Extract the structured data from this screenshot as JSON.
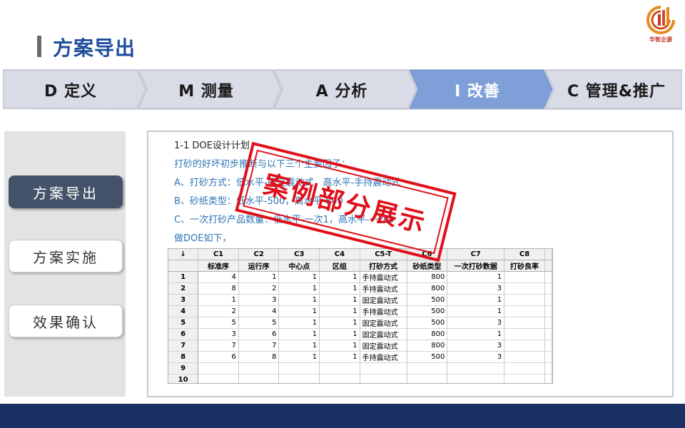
{
  "header": {
    "title": "方案导出",
    "logo_text": "华智企源"
  },
  "steps": [
    {
      "label": "D 定义",
      "active": false
    },
    {
      "label": "M 测量",
      "active": false
    },
    {
      "label": "A 分析",
      "active": false
    },
    {
      "label": "I 改善",
      "active": true
    },
    {
      "label": "C 管理&推广",
      "active": false
    }
  ],
  "sidebar": {
    "items": [
      {
        "label": "方案导出",
        "active": true
      },
      {
        "label": "方案实施",
        "active": false
      },
      {
        "label": "效果确认",
        "active": false
      }
    ]
  },
  "content": {
    "heading": "1-1 DOE设计计划",
    "lines": [
      "打砂的好坏初步推断与以下三个主要因子：",
      "A、打砂方式：低水平-固定震动式，高水平-手持震动式",
      "B、砂纸类型：低水平-500，高水平-800",
      "C、一次打砂产品数量：低水平-一次1，高水平-一次3",
      "做DOE如下，"
    ]
  },
  "stamp": {
    "text": "案例部分展示"
  },
  "sheet": {
    "corner": "↓",
    "col_ids": [
      "C1",
      "C2",
      "C3",
      "C4",
      "C5-T",
      "C6",
      "C7",
      "C8"
    ],
    "col_names": [
      "标准序",
      "运行序",
      "中心点",
      "区组",
      "打砂方式",
      "砂纸类型",
      "一次打砂数据",
      "打砂良率"
    ],
    "rows": [
      {
        "n": "1",
        "c1": "4",
        "c2": "1",
        "c3": "1",
        "c4": "1",
        "c5": "手持震动式",
        "c6": "800",
        "c7": "1",
        "c8": ""
      },
      {
        "n": "2",
        "c1": "8",
        "c2": "2",
        "c3": "1",
        "c4": "1",
        "c5": "手持震动式",
        "c6": "800",
        "c7": "3",
        "c8": ""
      },
      {
        "n": "3",
        "c1": "1",
        "c2": "3",
        "c3": "1",
        "c4": "1",
        "c5": "固定震动式",
        "c6": "500",
        "c7": "1",
        "c8": ""
      },
      {
        "n": "4",
        "c1": "2",
        "c2": "4",
        "c3": "1",
        "c4": "1",
        "c5": "手持震动式",
        "c6": "500",
        "c7": "1",
        "c8": ""
      },
      {
        "n": "5",
        "c1": "5",
        "c2": "5",
        "c3": "1",
        "c4": "1",
        "c5": "固定震动式",
        "c6": "500",
        "c7": "3",
        "c8": ""
      },
      {
        "n": "6",
        "c1": "3",
        "c2": "6",
        "c3": "1",
        "c4": "1",
        "c5": "固定震动式",
        "c6": "800",
        "c7": "1",
        "c8": ""
      },
      {
        "n": "7",
        "c1": "7",
        "c2": "7",
        "c3": "1",
        "c4": "1",
        "c5": "固定震动式",
        "c6": "800",
        "c7": "3",
        "c8": ""
      },
      {
        "n": "8",
        "c1": "6",
        "c2": "8",
        "c3": "1",
        "c4": "1",
        "c5": "手持震动式",
        "c6": "500",
        "c7": "3",
        "c8": ""
      },
      {
        "n": "9",
        "c1": "",
        "c2": "",
        "c3": "",
        "c4": "",
        "c5": "",
        "c6": "",
        "c7": "",
        "c8": ""
      },
      {
        "n": "10",
        "c1": "",
        "c2": "",
        "c3": "",
        "c4": "",
        "c5": "",
        "c6": "",
        "c7": "",
        "c8": ""
      }
    ]
  },
  "colors": {
    "title": "#1f4e9c",
    "step_active": "#7f9fd8",
    "step_inactive": "#d9dbe6",
    "sidebar_active": "#44536a",
    "text_blue": "#2e75b6",
    "stamp": "#e0101a",
    "footer": "#1c3163"
  }
}
